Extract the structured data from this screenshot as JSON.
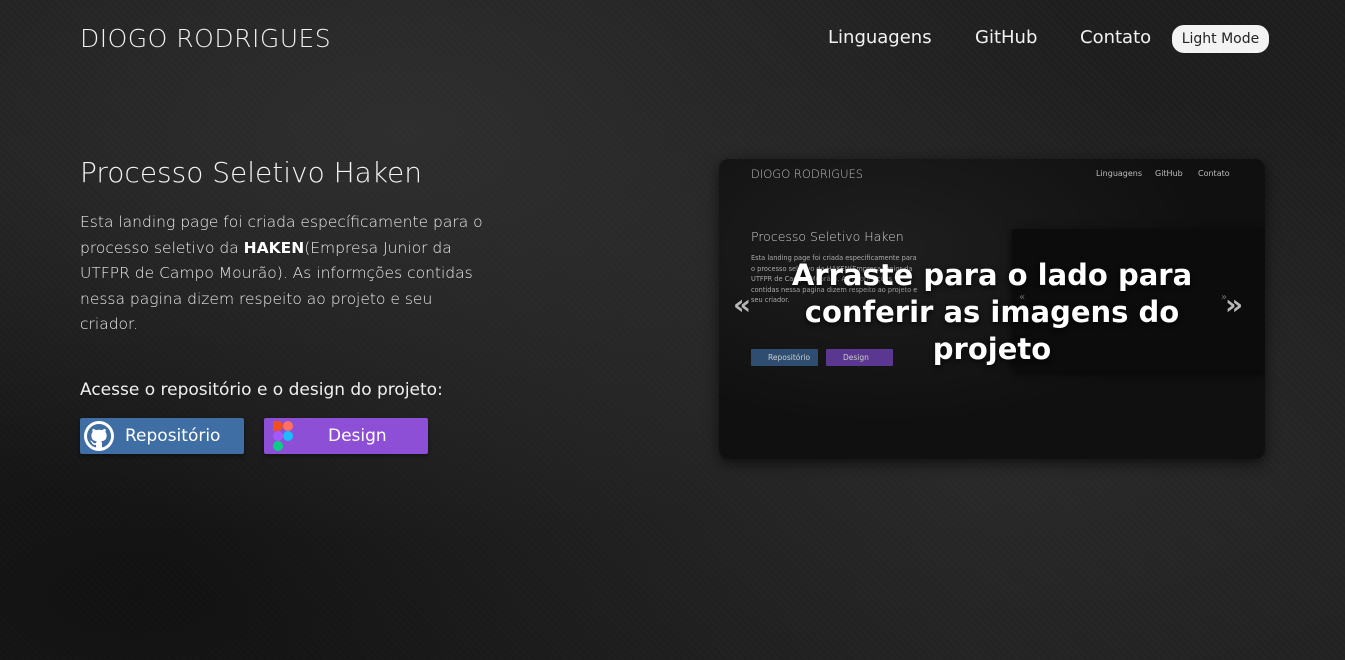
{
  "header": {
    "brand": "DIOGO RODRIGUES",
    "nav": [
      "Linguagens",
      "GitHub",
      "Contato"
    ],
    "mode_button": "Light Mode"
  },
  "hero": {
    "title": "Processo Seletivo Haken",
    "description_before": "Esta landing page foi criada específicamente para o processo seletivo da ",
    "description_bold": "HAKEN",
    "description_after": "(Empresa Junior da UTFPR de Campo Mourão). As informções contidas nessa pagina dizem respeito ao projeto e seu criador.",
    "access_label": "Acesse o repositório e o design do projeto:",
    "repo_button": "Repositório",
    "design_button": "Design"
  },
  "carousel": {
    "overlay": "Arraste para o lado para conferir as imagens do projeto",
    "prev_arrow": "«",
    "next_arrow": "»",
    "preview": {
      "brand": "DIOGO RODRIGUES",
      "nav": [
        "Linguagens",
        "GitHub",
        "Contato"
      ],
      "title": "Processo Seletivo Haken",
      "description": "Esta landing page foi criada especificamente para o processo seletivo da HAKEN(Empresa Junior da UTFPR de Campo Mourão). As informações contidas nessa pagina dizem respeito ao projeto e seu criador.",
      "repo_button": "Repositório",
      "design_button": "Design",
      "small_prev": "«",
      "small_next": "»"
    }
  },
  "colors": {
    "background": "#1e1e1e",
    "repo_button": "#3f6ea4",
    "design_button": "#8c4fd6",
    "mode_button": "#f3f3f3"
  },
  "icons": {
    "repo": "github-icon",
    "design": "figma-icon"
  }
}
